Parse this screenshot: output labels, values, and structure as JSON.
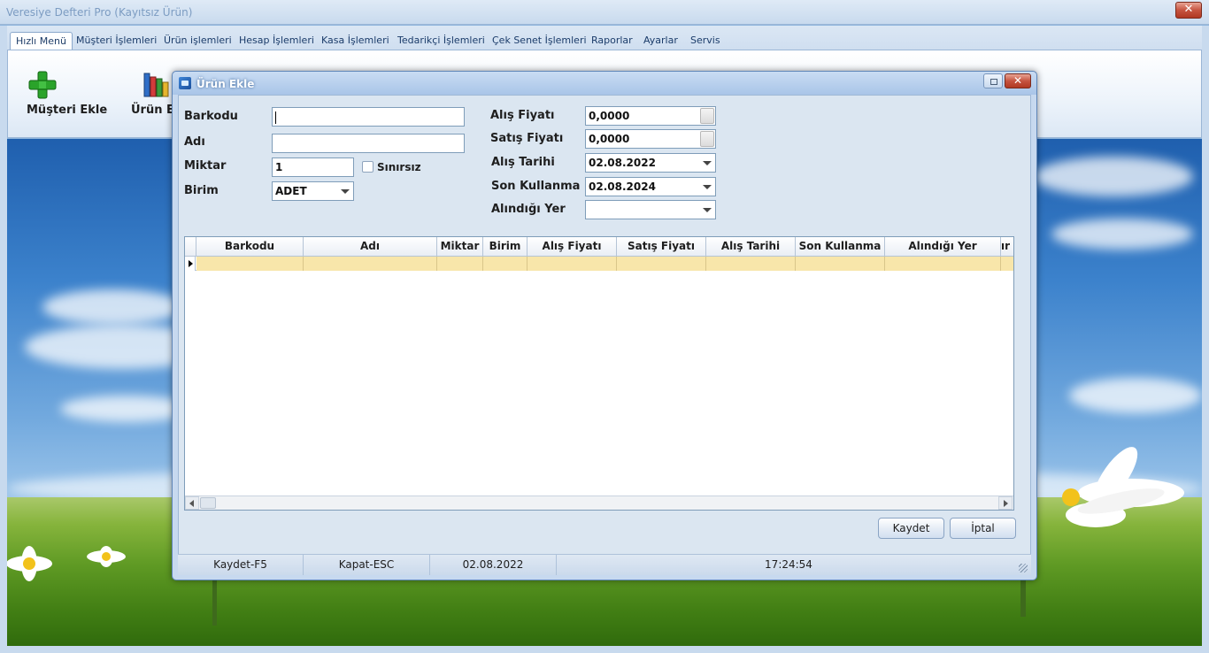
{
  "app": {
    "title": "Veresiye Defteri Pro (Kayıtsız Ürün)",
    "close_glyph": "✕"
  },
  "menu": {
    "tabs": [
      {
        "label": "Hızlı Menü"
      },
      {
        "label": "Müşteri İşlemleri"
      },
      {
        "label": "Ürün işlemleri"
      },
      {
        "label": "Hesap İşlemleri"
      },
      {
        "label": "Kasa İşlemleri"
      },
      {
        "label": "Tedarikçi İşlemleri"
      },
      {
        "label": "Çek Senet İşlemleri"
      },
      {
        "label": "Raporlar"
      },
      {
        "label": "Ayarlar"
      },
      {
        "label": "Servis"
      }
    ]
  },
  "ribbon": {
    "add_customer": "Müşteri Ekle",
    "add_product": "Ürün Ekle",
    "add_product_visible": "Ürün E"
  },
  "dialog": {
    "title": "Ürün Ekle",
    "close_glyph": "✕",
    "fields": {
      "barcode_label": "Barkodu",
      "barcode_value": "",
      "name_label": "Adı",
      "name_value": "",
      "quantity_label": "Miktar",
      "quantity_value": "1",
      "unlimited_label": "Sınırsız",
      "unit_label": "Birim",
      "unit_value": "ADET",
      "buy_price_label": "Alış Fiyatı",
      "buy_price_value": "0,0000",
      "sell_price_label": "Satış Fiyatı",
      "sell_price_value": "0,0000",
      "buy_date_label": "Alış Tarihi",
      "buy_date_value": "02.08.2022",
      "expiry_label": "Son Kullanma",
      "expiry_value": "02.08.2024",
      "source_label": "Alındığı Yer",
      "source_value": ""
    },
    "grid": {
      "columns": [
        "Barkodu",
        "Adı",
        "Miktar",
        "Birim",
        "Alış Fiyatı",
        "Satış Fiyatı",
        "Alış Tarihi",
        "Son Kullanma",
        "Alındığı Yer",
        "ır"
      ]
    },
    "buttons": {
      "save": "Kaydet",
      "cancel": "İptal"
    },
    "status": {
      "save_hint": "Kaydet-F5",
      "close_hint": "Kapat-ESC",
      "date": "02.08.2022",
      "time": "17:24:54"
    }
  },
  "colors": {
    "accent": "#1e3d68",
    "selected_row": "#f8e6aa",
    "dialog_bg": "#dbe6f1"
  }
}
